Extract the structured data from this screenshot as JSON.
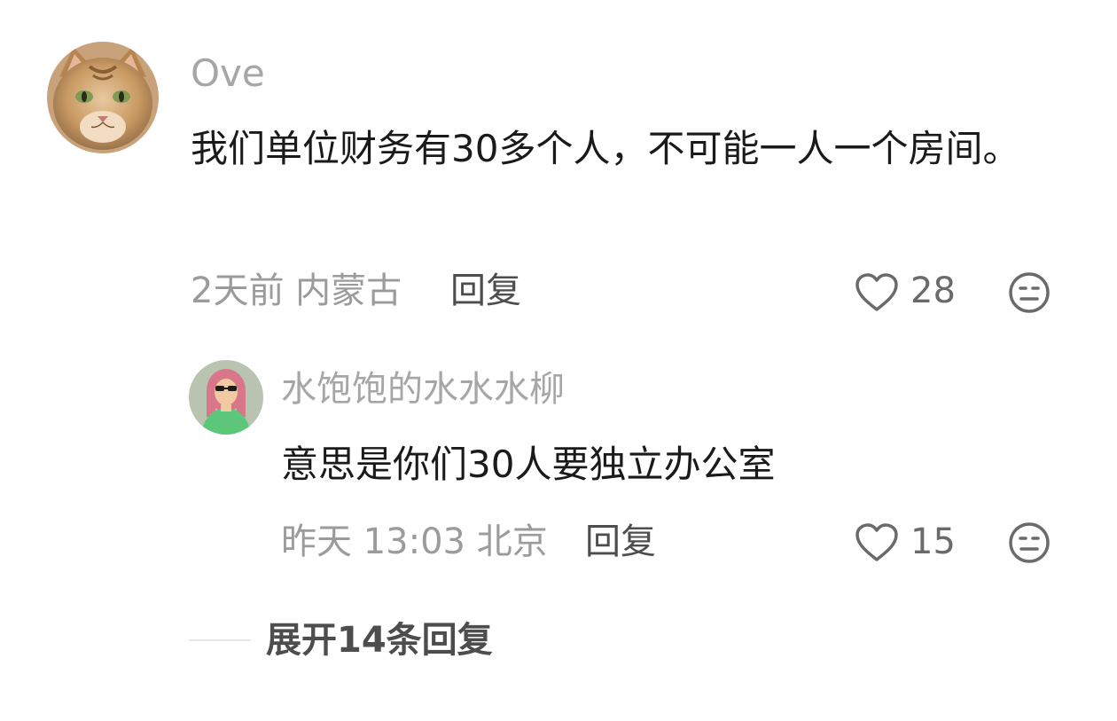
{
  "comment": {
    "username": "Ove",
    "text": "我们单位财务有30多个人，不可能一人一个房间。",
    "time": "2天前",
    "location": "内蒙古",
    "reply_label": "回复",
    "like_count": "28",
    "avatar_icon": "cat-avatar"
  },
  "reply": {
    "username": "水饱饱的水水水柳",
    "text": "意思是你们30人要独立办公室",
    "time": "昨天 13:03",
    "location": "北京",
    "reply_label": "回复",
    "like_count": "15",
    "avatar_icon": "illustrated-girl-avatar"
  },
  "expand": {
    "label": "展开14条回复"
  },
  "colors": {
    "username": "#a6a6a6",
    "text": "#1a1a1a",
    "meta": "#9b9b9b",
    "action": "#4d4d4d",
    "icon": "#6a6a6a"
  }
}
